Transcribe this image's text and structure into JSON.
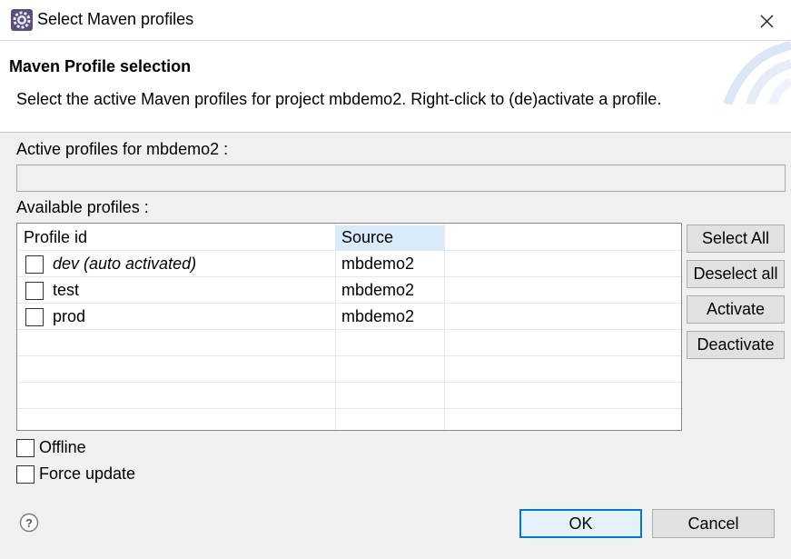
{
  "window": {
    "title": "Select Maven profiles",
    "icon": "eclipse-gear-icon",
    "close_icon": "close-icon"
  },
  "header": {
    "title": "Maven Profile selection",
    "description": "Select the active Maven profiles for project mbdemo2. Right-click to (de)activate a profile."
  },
  "active_profiles": {
    "label": "Active profiles for mbdemo2 :",
    "value": ""
  },
  "available_profiles": {
    "label": "Available profiles :",
    "columns": [
      "Profile id",
      "Source"
    ],
    "rows": [
      {
        "id": "dev (auto activated)",
        "source": "mbdemo2",
        "checked": false,
        "italic": true
      },
      {
        "id": "test",
        "source": "mbdemo2",
        "checked": false,
        "italic": false
      },
      {
        "id": "prod",
        "source": "mbdemo2",
        "checked": false,
        "italic": false
      }
    ]
  },
  "side_buttons": {
    "select_all": "Select All",
    "deselect_all": "Deselect all",
    "activate": "Activate",
    "deactivate": "Deactivate"
  },
  "options": {
    "offline": {
      "label": "Offline",
      "checked": false
    },
    "force_update": {
      "label": "Force update",
      "checked": false
    }
  },
  "footer": {
    "help_icon": "help-icon",
    "ok": "OK",
    "cancel": "Cancel"
  },
  "colors": {
    "ok_border": "#0078d7",
    "column_highlight": "#d9ebf9"
  }
}
